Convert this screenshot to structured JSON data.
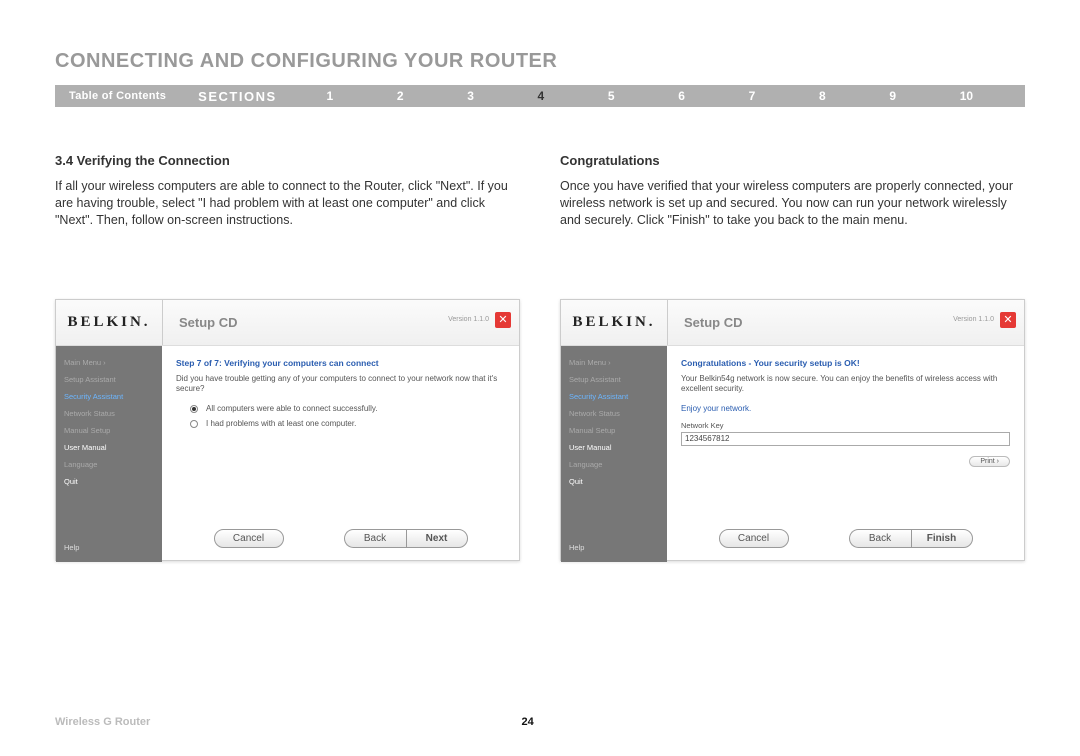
{
  "title": "CONNECTING AND CONFIGURING YOUR ROUTER",
  "nav": {
    "toc": "Table of Contents",
    "sections": "SECTIONS",
    "numbers": [
      "1",
      "2",
      "3",
      "4",
      "5",
      "6",
      "7",
      "8",
      "9",
      "10"
    ],
    "current": "4"
  },
  "left": {
    "heading": "3.4 Verifying the Connection",
    "body": "If all your wireless computers are able to connect to the Router, click \"Next\". If you are having trouble, select \"I had problem with at least one computer\" and click \"Next\". Then, follow on-screen instructions."
  },
  "right": {
    "heading": "Congratulations",
    "body": "Once you have verified that your wireless computers are properly connected, your wireless network is set up and secured. You now can run your network wirelessly and securely. Click \"Finish\" to take you back to the main menu."
  },
  "shot_common": {
    "logo": "BELKIN.",
    "product": "Setup CD",
    "version": "Version 1.1.0",
    "close": "✕",
    "help": "Help"
  },
  "sidebar": {
    "items": [
      "Main Menu  ›",
      "Setup Assistant",
      "Security Assistant",
      "Network Status",
      "Manual Setup",
      "User Manual",
      "Language",
      "Quit"
    ]
  },
  "shot1": {
    "step_title": "Step 7 of 7: Verifying your computers can connect",
    "question": "Did you have trouble getting any of your computers to connect to your network now that it's secure?",
    "opt1": "All computers were able to connect successfully.",
    "opt2": "I had problems with at least one computer.",
    "cancel": "Cancel",
    "back": "Back",
    "next": "Next"
  },
  "shot2": {
    "step_title": "Congratulations - Your security setup is OK!",
    "msg": "Your Belkin54g network is now secure. You can enjoy the benefits of wireless access with excellent security.",
    "enjoy": "Enjoy your network.",
    "keylabel": "Network Key",
    "keyval": "1234567812",
    "print": "Print ›",
    "cancel": "Cancel",
    "back": "Back",
    "finish": "Finish"
  },
  "footer": {
    "left": "Wireless G Router",
    "page": "24"
  }
}
